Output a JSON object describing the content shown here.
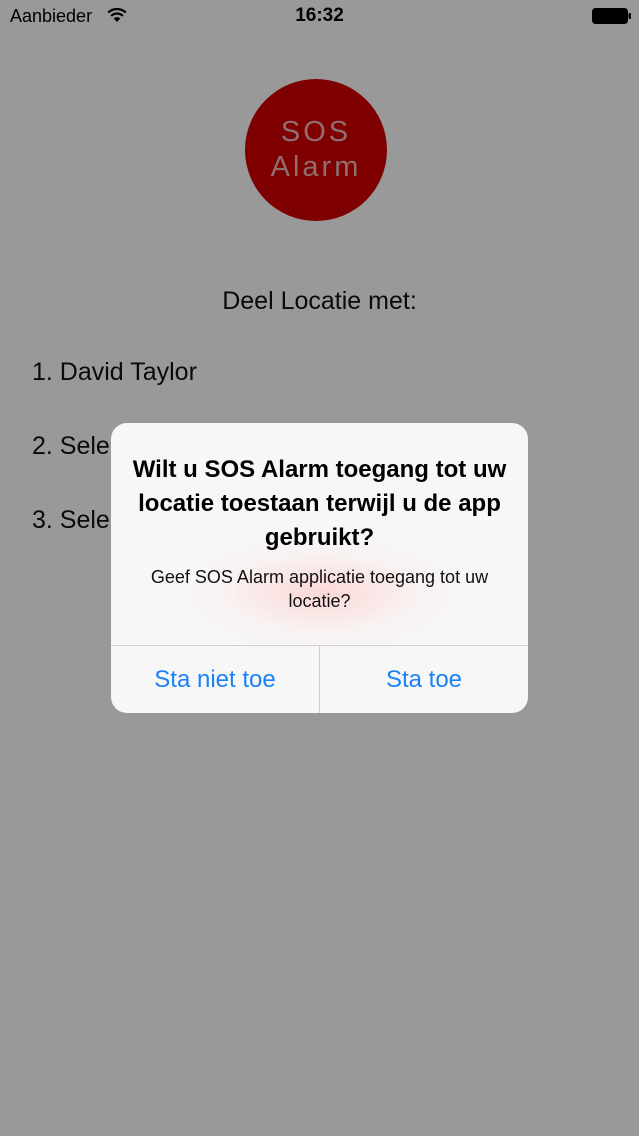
{
  "status_bar": {
    "carrier": "Aanbieder",
    "time": "16:32",
    "wifi_icon": "wifi-icon",
    "battery_icon": "battery-full-icon"
  },
  "main": {
    "sos_button": {
      "line1": "SOS",
      "line2": "Alarm",
      "color": "#d20000"
    },
    "share_title": "Deel Locatie met:",
    "contacts": [
      {
        "label": "1. David Taylor"
      },
      {
        "label": "2. Sele"
      },
      {
        "label": "3. Sele"
      }
    ]
  },
  "alert": {
    "title": "Wilt u SOS Alarm toegang tot uw locatie toestaan terwijl u de app gebruikt?",
    "message": "Geef SOS Alarm applicatie toegang tot uw locatie?",
    "buttons": {
      "deny": "Sta niet toe",
      "allow": "Sta toe"
    },
    "accent_color": "#1a82f7"
  }
}
